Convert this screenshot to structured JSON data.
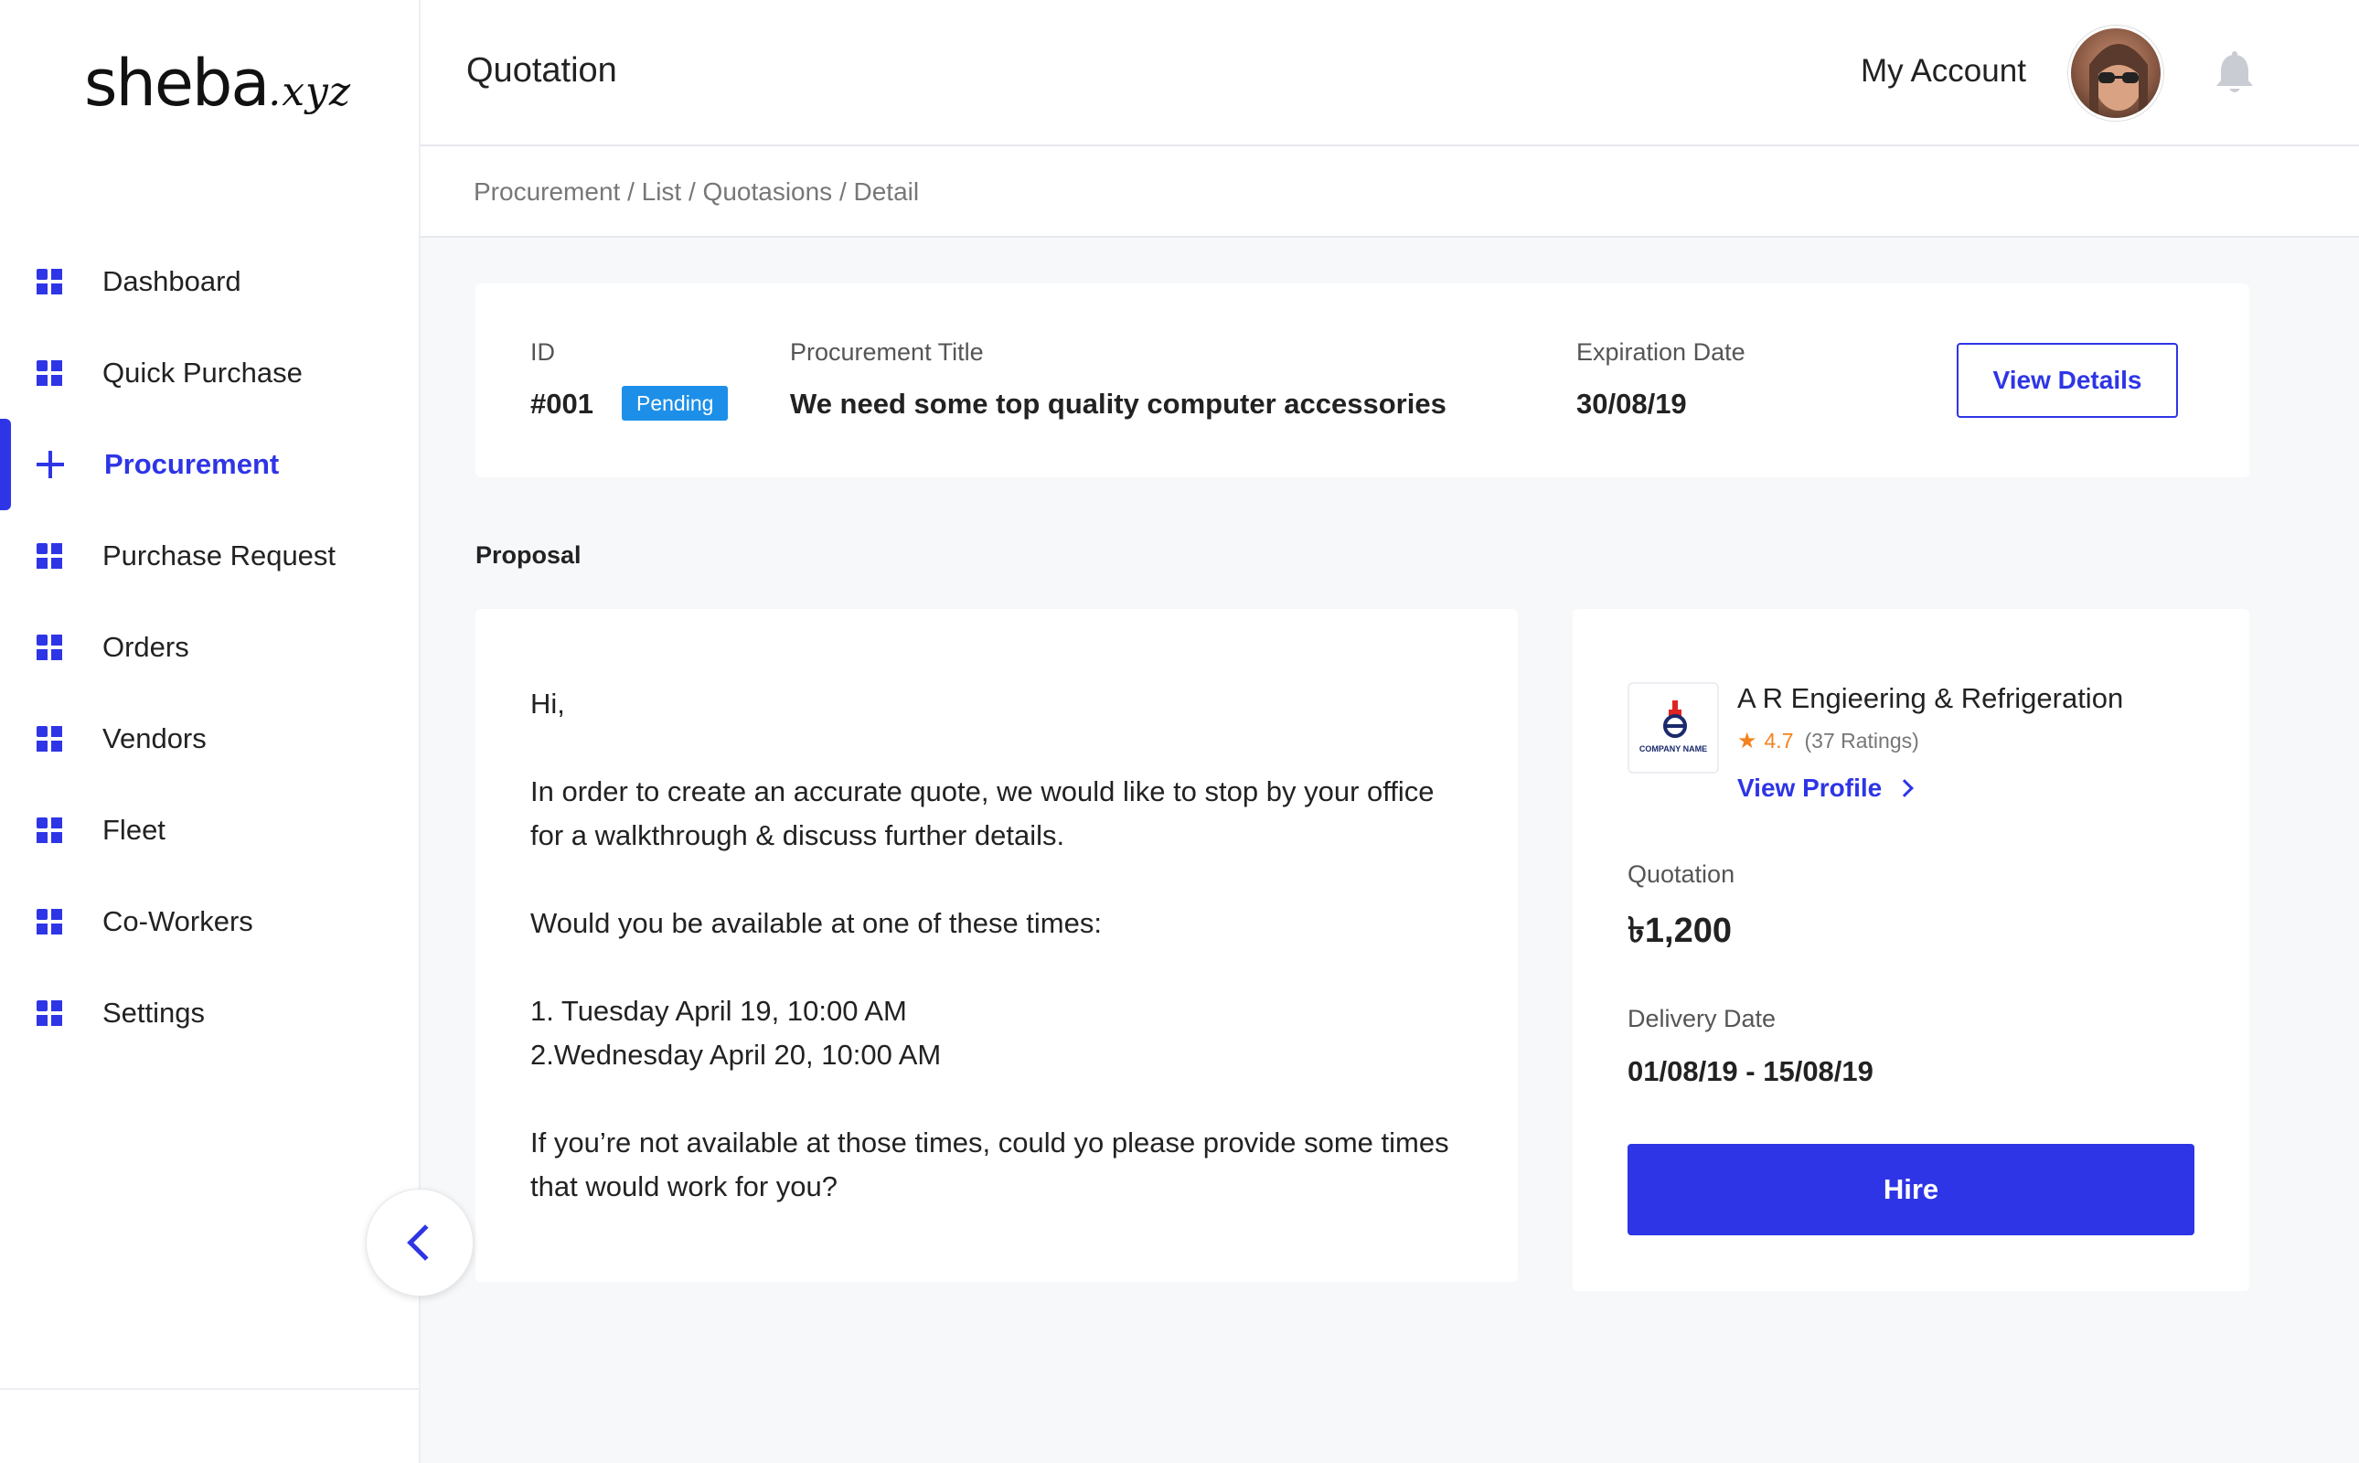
{
  "brand": {
    "name": "sheba",
    "suffix": ".xyz"
  },
  "header": {
    "title": "Quotation",
    "account_label": "My Account"
  },
  "breadcrumb": "Procurement / List / Quotasions / Detail",
  "sidebar": {
    "items": [
      {
        "label": "Dashboard",
        "icon": "grid-icon"
      },
      {
        "label": "Quick Purchase",
        "icon": "grid-icon"
      },
      {
        "label": "Procurement",
        "icon": "plus-icon",
        "active": true
      },
      {
        "label": "Purchase Request",
        "icon": "grid-icon"
      },
      {
        "label": "Orders",
        "icon": "grid-icon"
      },
      {
        "label": "Vendors",
        "icon": "grid-icon"
      },
      {
        "label": "Fleet",
        "icon": "grid-icon"
      },
      {
        "label": "Co-Workers",
        "icon": "grid-icon"
      },
      {
        "label": "Settings",
        "icon": "grid-icon"
      }
    ]
  },
  "summary": {
    "id_label": "ID",
    "id_value": "#001",
    "status": "Pending",
    "title_label": "Procurement Title",
    "title_value": "We need some top quality computer accessories",
    "expiration_label": "Expiration Date",
    "expiration_value": "30/08/19",
    "view_details_label": "View Details"
  },
  "proposal": {
    "section_title": "Proposal",
    "greeting": "Hi,",
    "line1": "In order to create an accurate quote, we would like to stop by your office for a walkthrough & discuss further details.",
    "line2": "Would you be available at one of these times:",
    "time1": "1. Tuesday April 19, 10:00 AM",
    "time2": "2.Wednesday April 20, 10:00 AM",
    "line3": "If you’re not available at those times, could yo please provide some times that would work for you?"
  },
  "vendor": {
    "logo_text": "COMPANY NAME",
    "name": "A R Engieering & Refrigeration",
    "rating": "4.7",
    "rating_count": "(37 Ratings)",
    "view_profile_label": "View Profile",
    "quotation_label": "Quotation",
    "quotation_value": "৳1,200",
    "delivery_label": "Delivery Date",
    "delivery_value": "01/08/19 - 15/08/19",
    "hire_label": "Hire"
  },
  "colors": {
    "accent": "#2e35e6",
    "badge": "#1d8fe8",
    "rating": "#f5821f",
    "background": "#f7f8fa"
  }
}
